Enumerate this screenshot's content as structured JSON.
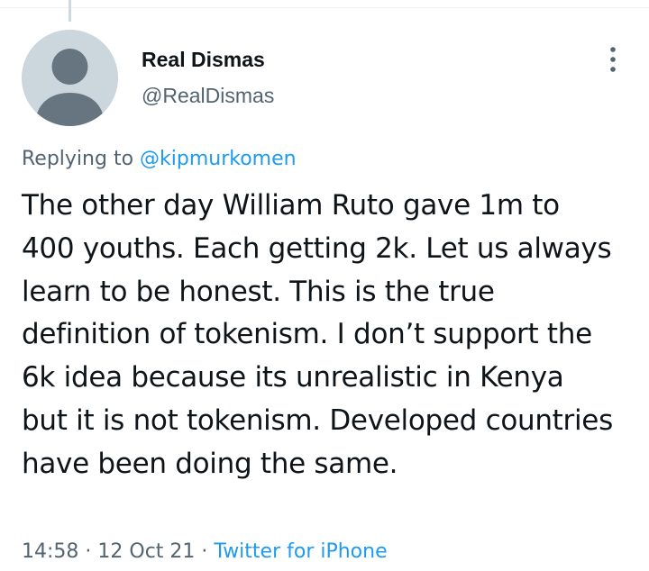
{
  "tweet": {
    "author": {
      "display_name": "Real Dismas",
      "handle": "@RealDismas"
    },
    "reply": {
      "prefix": "Replying to ",
      "mention": "@kipmurkomen"
    },
    "text": "The other day William Ruto gave 1m to 400 youths. Each getting 2k. Let us always learn to be honest. This is the true definition of tokenism. I don’t support the 6k idea because its unrealistic in Kenya but it is not tokenism. Developed countries have been doing the same.",
    "time": "14:58",
    "date": "12 Oct 21",
    "separator": " · ",
    "source": "Twitter for iPhone"
  },
  "icons": {
    "avatar": "default-avatar-icon",
    "more": "more-options-icon"
  },
  "colors": {
    "link": "#1d9bf0",
    "secondary_text": "#536471",
    "primary_text": "#0f1419",
    "avatar_bg": "#ccd6dd",
    "avatar_fg": "#66757f"
  }
}
